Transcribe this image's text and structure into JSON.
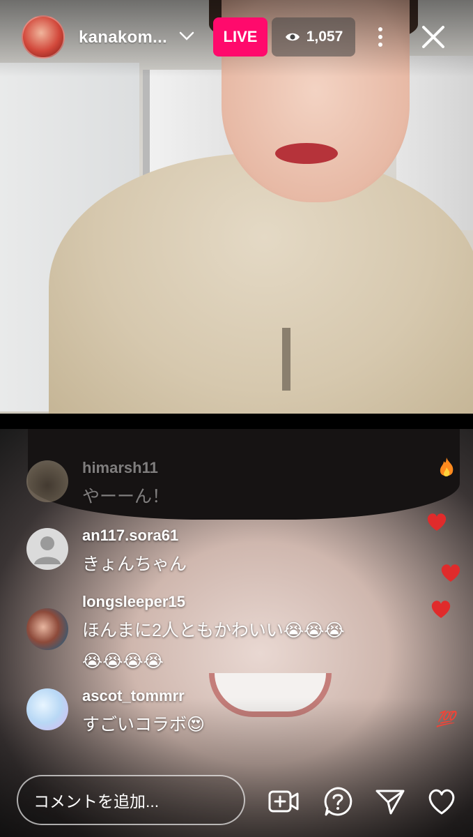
{
  "header": {
    "username": "kanakom...",
    "live_label": "LIVE",
    "viewer_count": "1,057"
  },
  "comments": [
    {
      "user": "himarsh11",
      "text": "やーーん！",
      "faded": true
    },
    {
      "user": "an117.sora61",
      "text": "きょんちゃん"
    },
    {
      "user": "longsleeper15",
      "text": "ほんまに2人ともかわいい😭😭😭",
      "text2": "😭😭😭😭"
    },
    {
      "user": "ascot_tommrr",
      "text": "すごいコラボ😍"
    }
  ],
  "side_reactions": {
    "hundred": "💯"
  },
  "bottom_bar": {
    "comment_placeholder": "コメントを追加..."
  },
  "colors": {
    "live_badge": "#ff0a6c",
    "heart": "#e02b2b"
  }
}
